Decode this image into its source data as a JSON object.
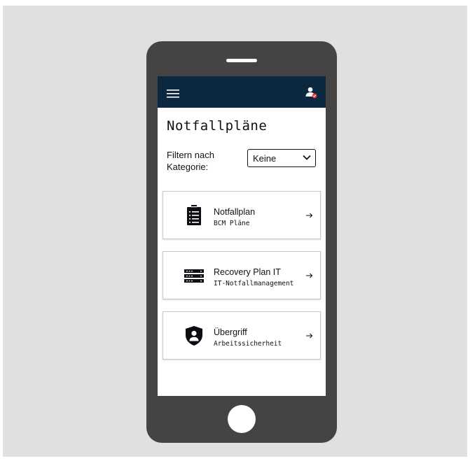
{
  "app": {
    "title": "Notfallpläne"
  },
  "filter": {
    "label": "Filtern nach Kategorie:",
    "selected": "Keine"
  },
  "cards": [
    {
      "title": "Notfallplan",
      "subtitle": "BCM Pläne",
      "icon": "clipboard-list-icon"
    },
    {
      "title": "Recovery Plan IT",
      "subtitle": "IT-Notfallmanagement",
      "icon": "server-icon"
    },
    {
      "title": "Übergriff",
      "subtitle": "Arbeitssicherheit",
      "icon": "shield-user-icon"
    }
  ],
  "colors": {
    "topbar": "#0c2840",
    "phone_body": "#444444",
    "background": "#e0e0e0",
    "badge": "#e53935"
  }
}
